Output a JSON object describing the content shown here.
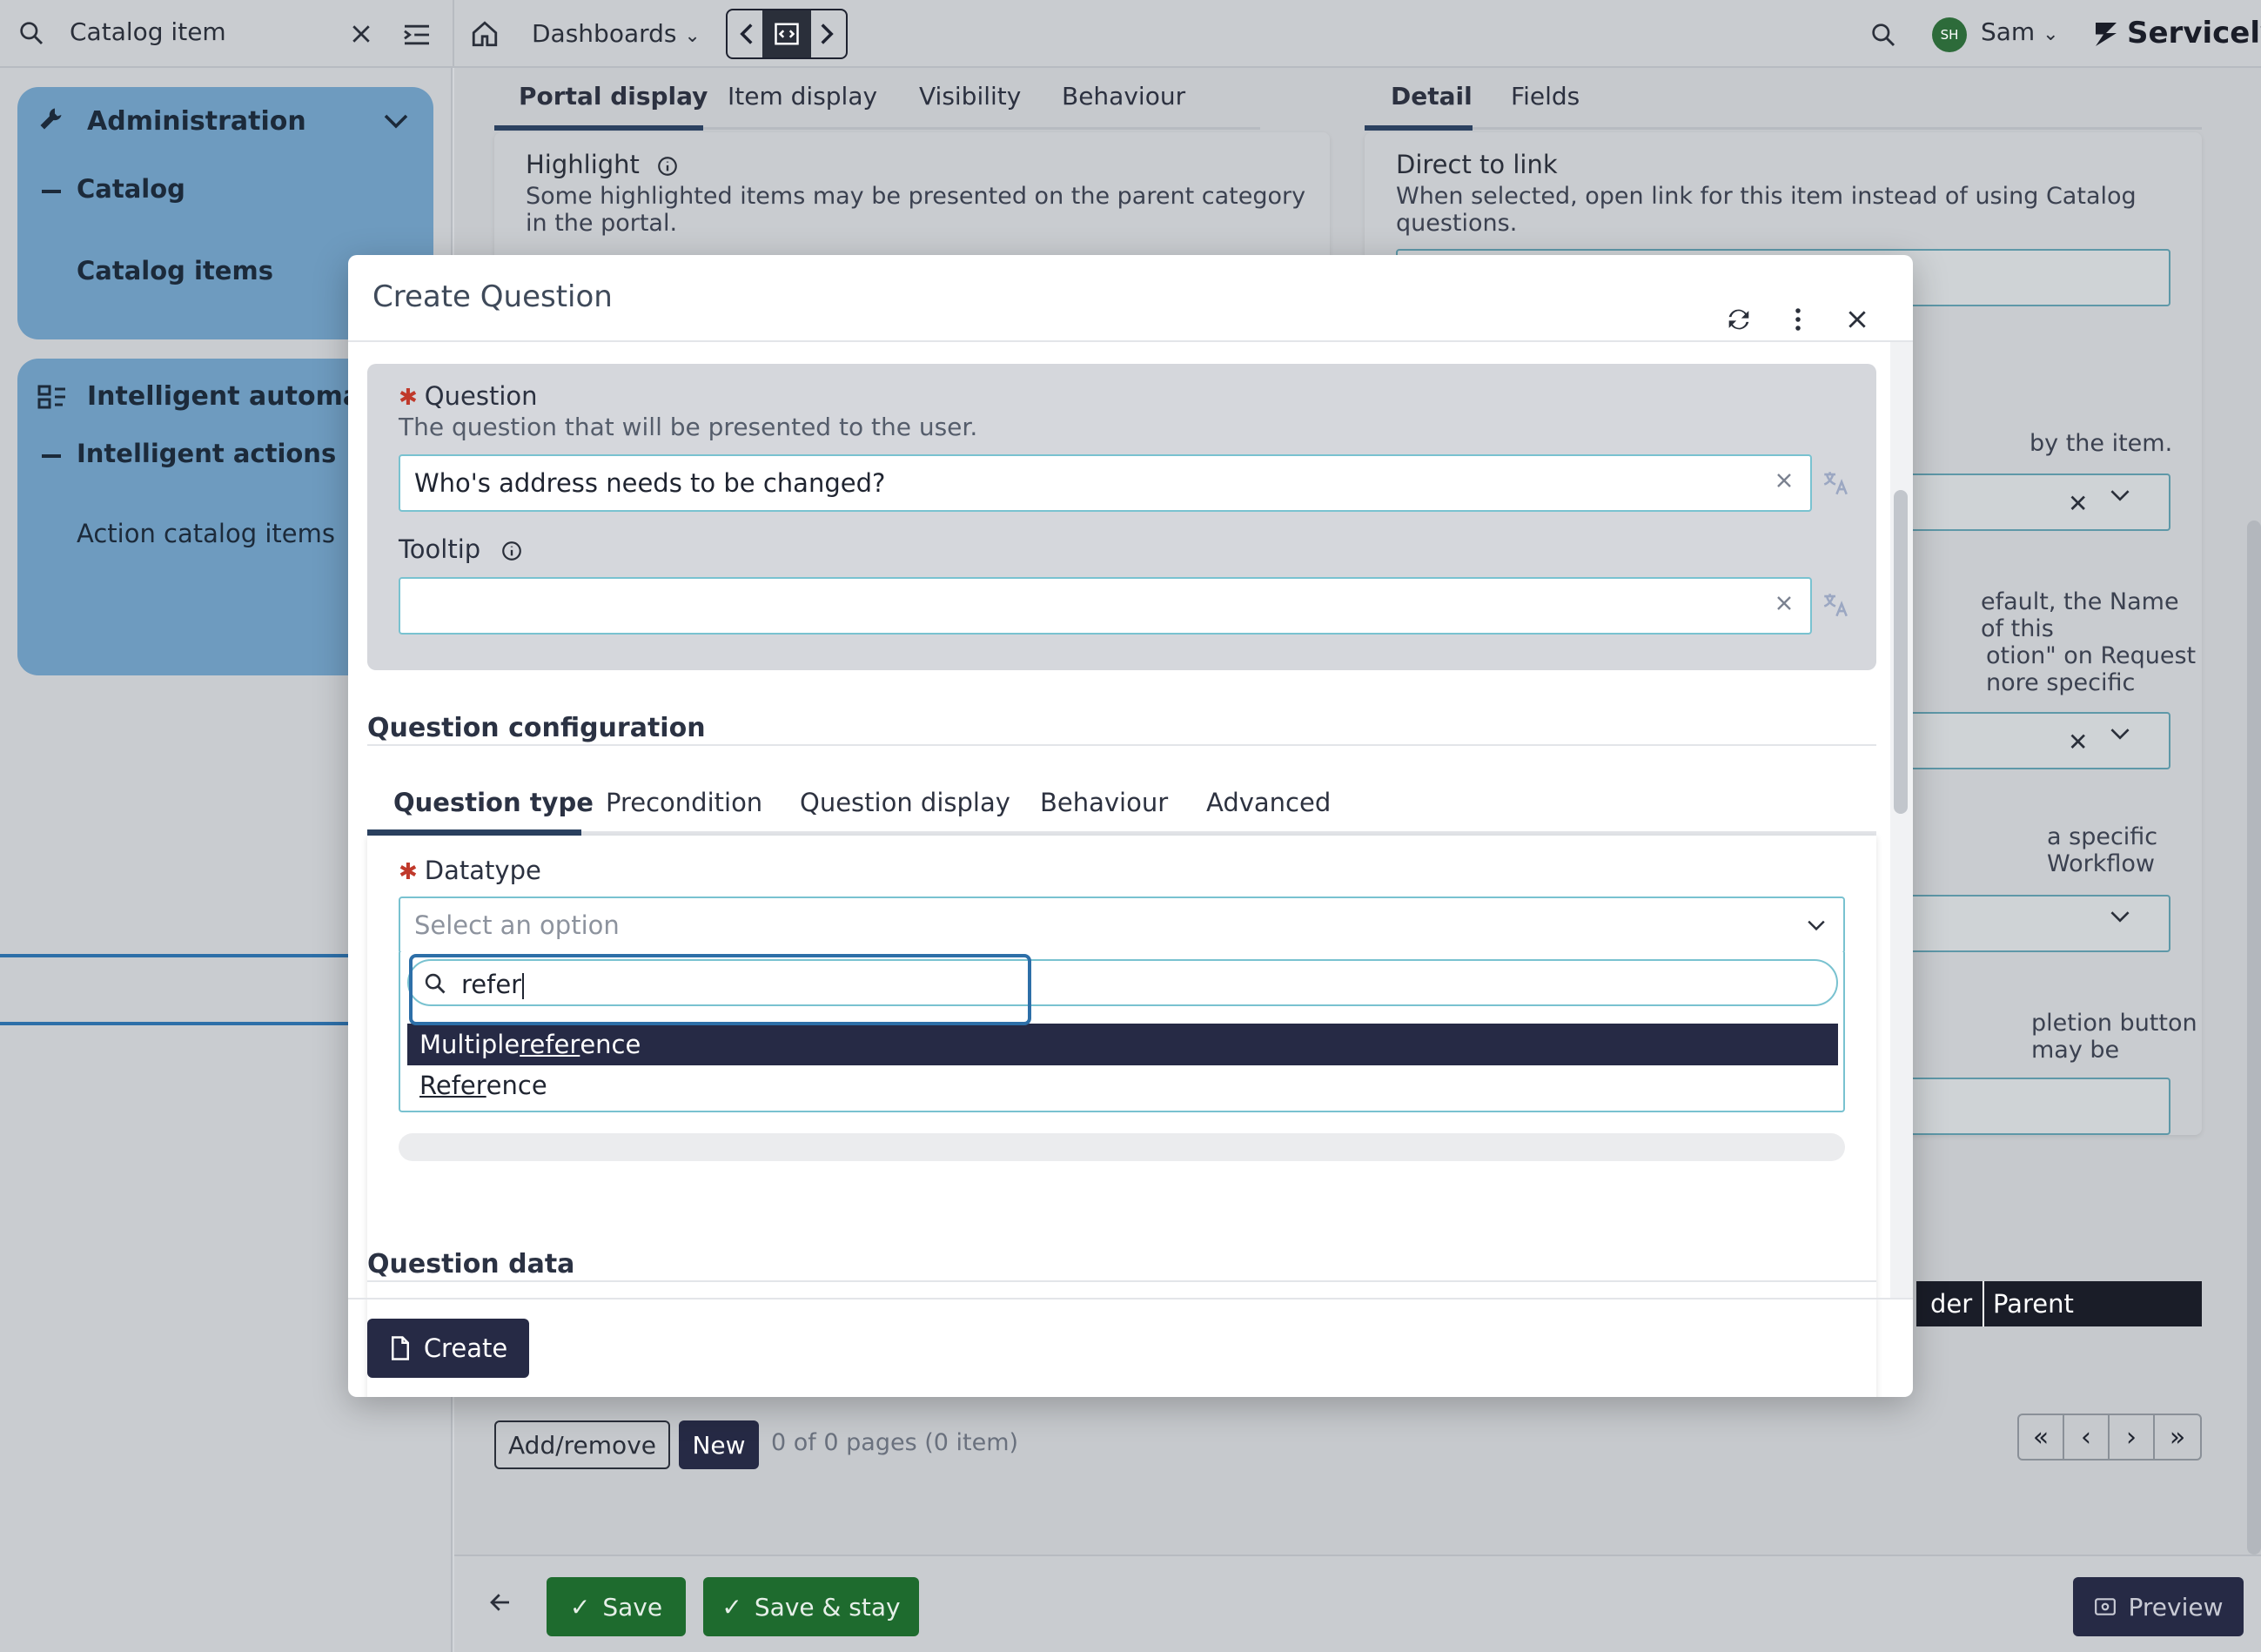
{
  "topbar": {
    "search_value": "Catalog item",
    "dashboards_label": "Dashboards",
    "user_initials": "SH",
    "user_name": "Sam",
    "brand": "Servicely"
  },
  "sidebar": {
    "admin_title": "Administration",
    "catalog_label": "Catalog",
    "catalog_items_label": "Catalog items",
    "intel_title": "Intelligent automatio",
    "intel_actions_label": "Intelligent actions",
    "action_catalog_label": "Action catalog items"
  },
  "background": {
    "left_tabs": [
      "Portal display",
      "Item display",
      "Visibility",
      "Behaviour"
    ],
    "right_tabs": [
      "Detail",
      "Fields"
    ],
    "highlight_label": "Highlight",
    "highlight_desc_1": "Some highlighted items may be presented on the parent category",
    "highlight_desc_2": "in the portal.",
    "direct_link_label": "Direct to link",
    "direct_link_desc_1": "When selected, open link for this item instead of using Catalog",
    "direct_link_desc_2": "questions.",
    "frag_1": "by the item.",
    "frag_2": "efault, the Name of this",
    "frag_3": "otion\" on Request",
    "frag_4": "nore specific",
    "frag_5": "a specific Workflow",
    "frag_6": "pletion button may be",
    "table_header_frag": "der",
    "table_header_parent": "Parent",
    "add_remove_label": "Add/remove",
    "new_label": "New",
    "pagination_text": "0 of 0 pages (0 item)",
    "save_label": "Save",
    "save_stay_label": "Save & stay",
    "preview_label": "Preview"
  },
  "modal": {
    "title": "Create Question",
    "question_label": "Question",
    "question_desc": "The question that will be presented to the user.",
    "question_value": "Who's address needs to be changed?",
    "tooltip_label": "Tooltip",
    "tooltip_value": "",
    "config_title": "Question configuration",
    "config_tabs": [
      "Question type",
      "Precondition",
      "Question display",
      "Behaviour",
      "Advanced"
    ],
    "datatype_label": "Datatype",
    "datatype_placeholder": "Select an option",
    "search_value": "refer",
    "options": [
      {
        "pre": "Multiple ",
        "match": "refer",
        "post": "ence"
      },
      {
        "pre": "",
        "match": "Refer",
        "post": "ence"
      }
    ],
    "question_data_title": "Question data",
    "create_label": "Create"
  },
  "colors": {
    "primary_dark": "#262a45",
    "accent_teal": "#79c2d0",
    "sidebar_card": "#6e9bbf",
    "save_green": "#1e6b2e",
    "highlight_blue": "#2d6fa8",
    "required_red": "#c0392b"
  }
}
